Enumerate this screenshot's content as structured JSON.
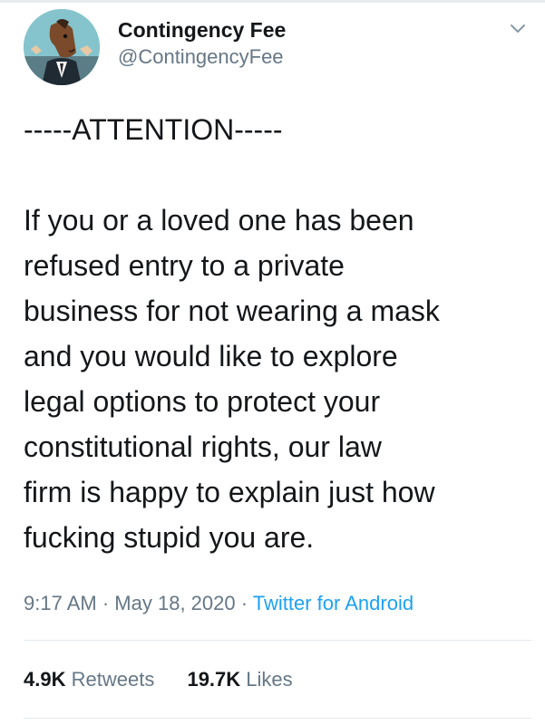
{
  "tweet": {
    "author": {
      "display_name": "Contingency Fee",
      "handle": "@ContingencyFee",
      "avatar_icon": "cartoon-horse-lawyer-avatar"
    },
    "attention": "-----ATTENTION-----",
    "text": "If you or a loved one has been\nrefused entry to a private\nbusiness for not wearing a mask\nand you would like to explore\nlegal options to protect your\nconstitutional rights, our law\nfirm is happy to explain just how\nfucking stupid you are.",
    "time": "9:17 AM",
    "date": "May 18, 2020",
    "separator": "·",
    "source": "Twitter for Android",
    "retweets": {
      "count": "4.9K",
      "label": "Retweets"
    },
    "likes": {
      "count": "19.7K",
      "label": "Likes"
    }
  },
  "colors": {
    "text": "#14171a",
    "secondary": "#657786",
    "link": "#1da1f2",
    "divider": "#e1e8ed"
  }
}
